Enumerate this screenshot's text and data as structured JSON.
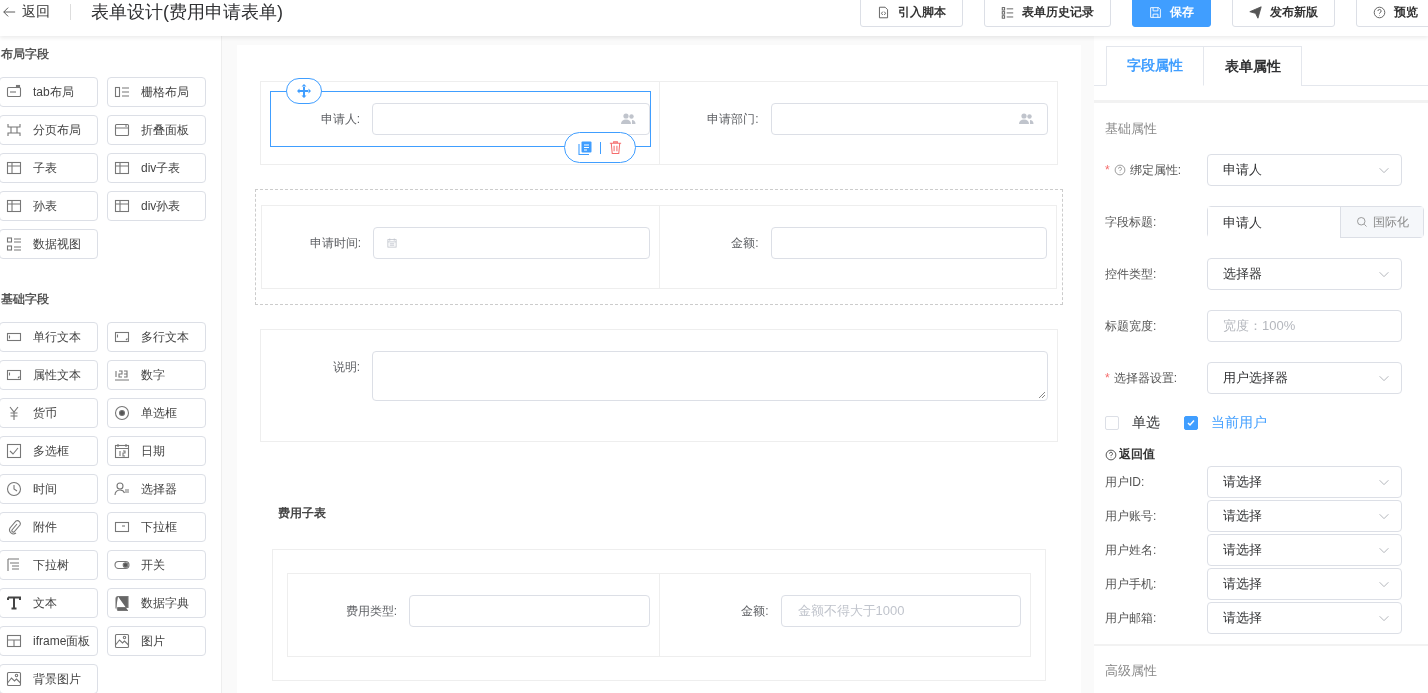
{
  "header": {
    "back": "返回",
    "title": "表单设计(费用申请表单)",
    "buttons": [
      {
        "label": "引入脚本",
        "kind": "script",
        "primary": false
      },
      {
        "label": "表单历史记录",
        "kind": "history",
        "primary": false
      },
      {
        "label": "保存",
        "kind": "save",
        "primary": true
      },
      {
        "label": "发布新版",
        "kind": "publish",
        "primary": false
      },
      {
        "label": "预览",
        "kind": "preview",
        "primary": false
      }
    ]
  },
  "palette": [
    {
      "title": "布局字段",
      "items": [
        {
          "label": "tab布局",
          "kind": "tab"
        },
        {
          "label": "栅格布局",
          "kind": "grid"
        },
        {
          "label": "分页布局",
          "kind": "pager"
        },
        {
          "label": "折叠面板",
          "kind": "collapse"
        },
        {
          "label": "子表",
          "kind": "table"
        },
        {
          "label": "div子表",
          "kind": "table"
        },
        {
          "label": "孙表",
          "kind": "table"
        },
        {
          "label": "div孙表",
          "kind": "table"
        },
        {
          "label": "数据视图",
          "kind": "dataview"
        }
      ]
    },
    {
      "title": "基础字段",
      "items": [
        {
          "label": "单行文本",
          "kind": "input"
        },
        {
          "label": "多行文本",
          "kind": "textarea"
        },
        {
          "label": "属性文本",
          "kind": "textarea"
        },
        {
          "label": "数字",
          "kind": "number"
        },
        {
          "label": "货币",
          "kind": "currency"
        },
        {
          "label": "单选框",
          "kind": "radio"
        },
        {
          "label": "多选框",
          "kind": "checkbox"
        },
        {
          "label": "日期",
          "kind": "date"
        },
        {
          "label": "时间",
          "kind": "time"
        },
        {
          "label": "选择器",
          "kind": "selector"
        },
        {
          "label": "附件",
          "kind": "attach"
        },
        {
          "label": "下拉框",
          "kind": "dropdown"
        },
        {
          "label": "下拉树",
          "kind": "tree"
        },
        {
          "label": "开关",
          "kind": "switch"
        },
        {
          "label": "文本",
          "kind": "text"
        },
        {
          "label": "数据字典",
          "kind": "dict"
        },
        {
          "label": "iframe面板",
          "kind": "iframe"
        },
        {
          "label": "图片",
          "kind": "image"
        },
        {
          "label": "背景图片",
          "kind": "image"
        }
      ]
    }
  ],
  "form": {
    "sections": [
      {
        "kind": "grid",
        "fields": [
          {
            "label": "申请人:",
            "kind": "user",
            "selected": true
          },
          {
            "label": "申请部门:",
            "kind": "user",
            "selected": false
          }
        ]
      },
      {
        "kind": "grid-dashed",
        "fields": [
          {
            "label": "申请时间:",
            "kind": "date",
            "selected": false
          },
          {
            "label": "金额:",
            "kind": "text",
            "selected": false
          }
        ]
      },
      {
        "kind": "single",
        "fields": [
          {
            "label": "说明:",
            "kind": "textarea",
            "selected": false
          }
        ]
      },
      {
        "kind": "subtable",
        "title": "费用子表",
        "fields": [
          {
            "label": "费用类型:",
            "kind": "text",
            "selected": false
          },
          {
            "label": "金额:",
            "kind": "text",
            "placeholder": "金额不得大于1000",
            "selected": false
          }
        ]
      }
    ]
  },
  "properties": {
    "tabs": [
      {
        "label": "字段属性",
        "selected": true
      },
      {
        "label": "表单属性",
        "selected": false
      }
    ],
    "basic_title": "基础属性",
    "required_mark": "*",
    "rows": [
      {
        "label": "绑定属性:",
        "required": true,
        "help": true,
        "kind": "select",
        "value": "申请人"
      },
      {
        "label": "字段标题:",
        "required": false,
        "help": false,
        "kind": "input-addon",
        "value": "申请人",
        "addon": "国际化"
      },
      {
        "label": "控件类型:",
        "required": false,
        "help": false,
        "kind": "select",
        "value": "选择器"
      },
      {
        "label": "标题宽度:",
        "required": false,
        "help": false,
        "kind": "input",
        "placeholder": "宽度：100%"
      },
      {
        "label": "选择器设置:",
        "required": true,
        "help": false,
        "kind": "select",
        "value": "用户选择器"
      }
    ],
    "options": [
      {
        "label": "单选",
        "checked": false
      },
      {
        "label": "当前用户",
        "checked": true
      }
    ],
    "return_title": "返回值",
    "return_rows": [
      {
        "label": "用户ID:",
        "value": "请选择"
      },
      {
        "label": "用户账号:",
        "value": "请选择"
      },
      {
        "label": "用户姓名:",
        "value": "请选择"
      },
      {
        "label": "用户手机:",
        "value": "请选择"
      },
      {
        "label": "用户邮箱:",
        "value": "请选择"
      }
    ],
    "advanced_title": "高级属性"
  }
}
